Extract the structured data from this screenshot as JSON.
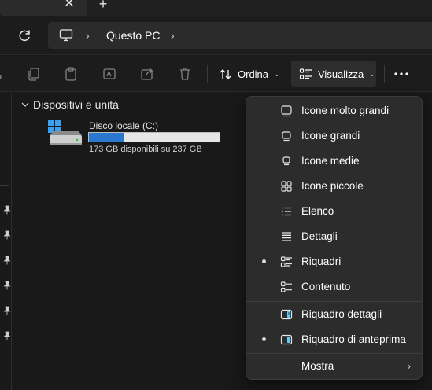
{
  "tabs": {
    "close_glyph": "✕",
    "new_tab_glyph": "+"
  },
  "address": {
    "location": "Questo PC"
  },
  "toolbar": {
    "sort_label": "Ordina",
    "view_label": "Visualizza",
    "more_glyph": "•••"
  },
  "content": {
    "group_title": "Dispositivi e unità",
    "drive": {
      "name": "Disco locale (C:)",
      "free_text": "173 GB disponibili su 237 GB",
      "used_fraction": 0.27
    }
  },
  "view_menu": {
    "items": [
      {
        "label": "Icone molto grandi",
        "icon": "extra-large-icons-icon",
        "selected": false
      },
      {
        "label": "Icone grandi",
        "icon": "large-icons-icon",
        "selected": false
      },
      {
        "label": "Icone medie",
        "icon": "medium-icons-icon",
        "selected": false
      },
      {
        "label": "Icone piccole",
        "icon": "small-icons-icon",
        "selected": false
      },
      {
        "label": "Elenco",
        "icon": "list-icon",
        "selected": false
      },
      {
        "label": "Dettagli",
        "icon": "details-icon",
        "selected": false
      },
      {
        "label": "Riquadri",
        "icon": "tiles-icon",
        "selected": true
      },
      {
        "label": "Contenuto",
        "icon": "content-icon",
        "selected": false
      }
    ],
    "panes": [
      {
        "label": "Riquadro dettagli",
        "icon": "details-pane-icon",
        "selected": false
      },
      {
        "label": "Riquadro di anteprima",
        "icon": "preview-pane-icon",
        "selected": true
      }
    ],
    "show_label": "Mostra",
    "accent_color": "#60cdff"
  }
}
